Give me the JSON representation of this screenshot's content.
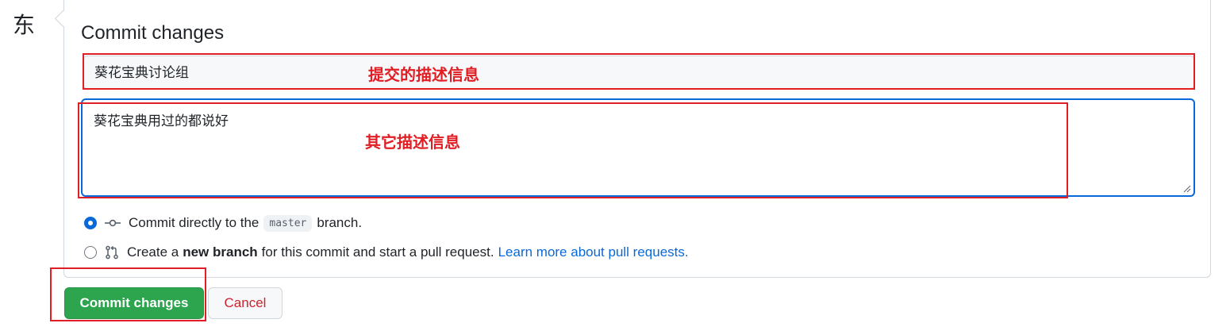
{
  "avatar_char": "东",
  "commit_form": {
    "title": "Commit changes",
    "summary_value": "葵花宝典讨论组",
    "description_value": "葵花宝典用过的都说好",
    "options": [
      {
        "checked": true,
        "text_before": "Commit directly to the",
        "branch_code": "master",
        "text_after": "branch."
      },
      {
        "checked": false,
        "text_before": "Create a",
        "bold": "new branch",
        "text_after": "for this commit and start a pull request.",
        "link": "Learn more about pull requests."
      }
    ],
    "commit_button": "Commit changes",
    "cancel_button": "Cancel"
  },
  "annotations": {
    "summary_label": "提交的描述信息",
    "description_label": "其它描述信息"
  },
  "colors": {
    "annotation_red": "#e01e24",
    "primary_green": "#2da44e",
    "focus_blue": "#0969da",
    "cancel_red": "#cf222e"
  },
  "icons": {
    "commit_option": "git-commit-icon",
    "branch_option": "git-pull-request-icon"
  }
}
